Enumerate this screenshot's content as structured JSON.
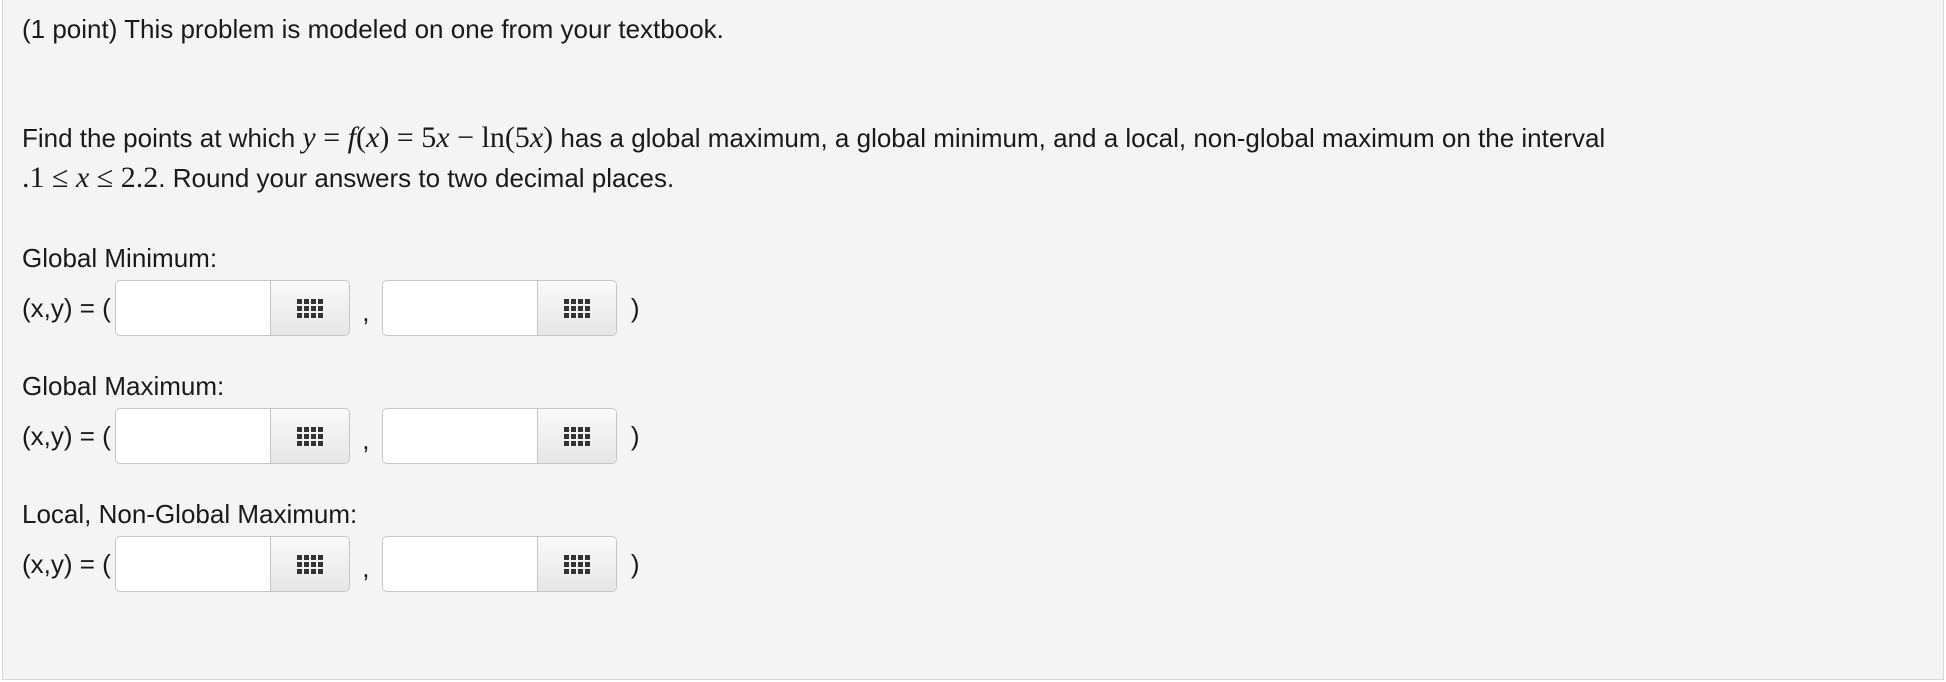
{
  "problem": {
    "intro": "(1 point) This problem is modeled on one from your textbook.",
    "statement": {
      "before": "Find the points at which ",
      "after_function": " has a global maximum, a global minimum, and a local, non-global maximum on the interval",
      "after_interval": ". Round your answers to two decimal places."
    }
  },
  "sections": [
    {
      "label": "Global Minimum:",
      "prefix": "(x,y) = (",
      "comma": ",",
      "close": ")",
      "x_value": "",
      "y_value": ""
    },
    {
      "label": "Global Maximum:",
      "prefix": "(x,y) = (",
      "comma": ",",
      "close": ")",
      "x_value": "",
      "y_value": ""
    },
    {
      "label": "Local, Non-Global Maximum:",
      "prefix": "(x,y) = (",
      "comma": ",",
      "close": ")",
      "x_value": "",
      "y_value": ""
    }
  ],
  "icons": {
    "palette": "equation-palette-icon"
  },
  "colors": {
    "panel_background": "#f4f4f4",
    "text": "#1a1a1a",
    "input_border": "#c6c6c6"
  }
}
